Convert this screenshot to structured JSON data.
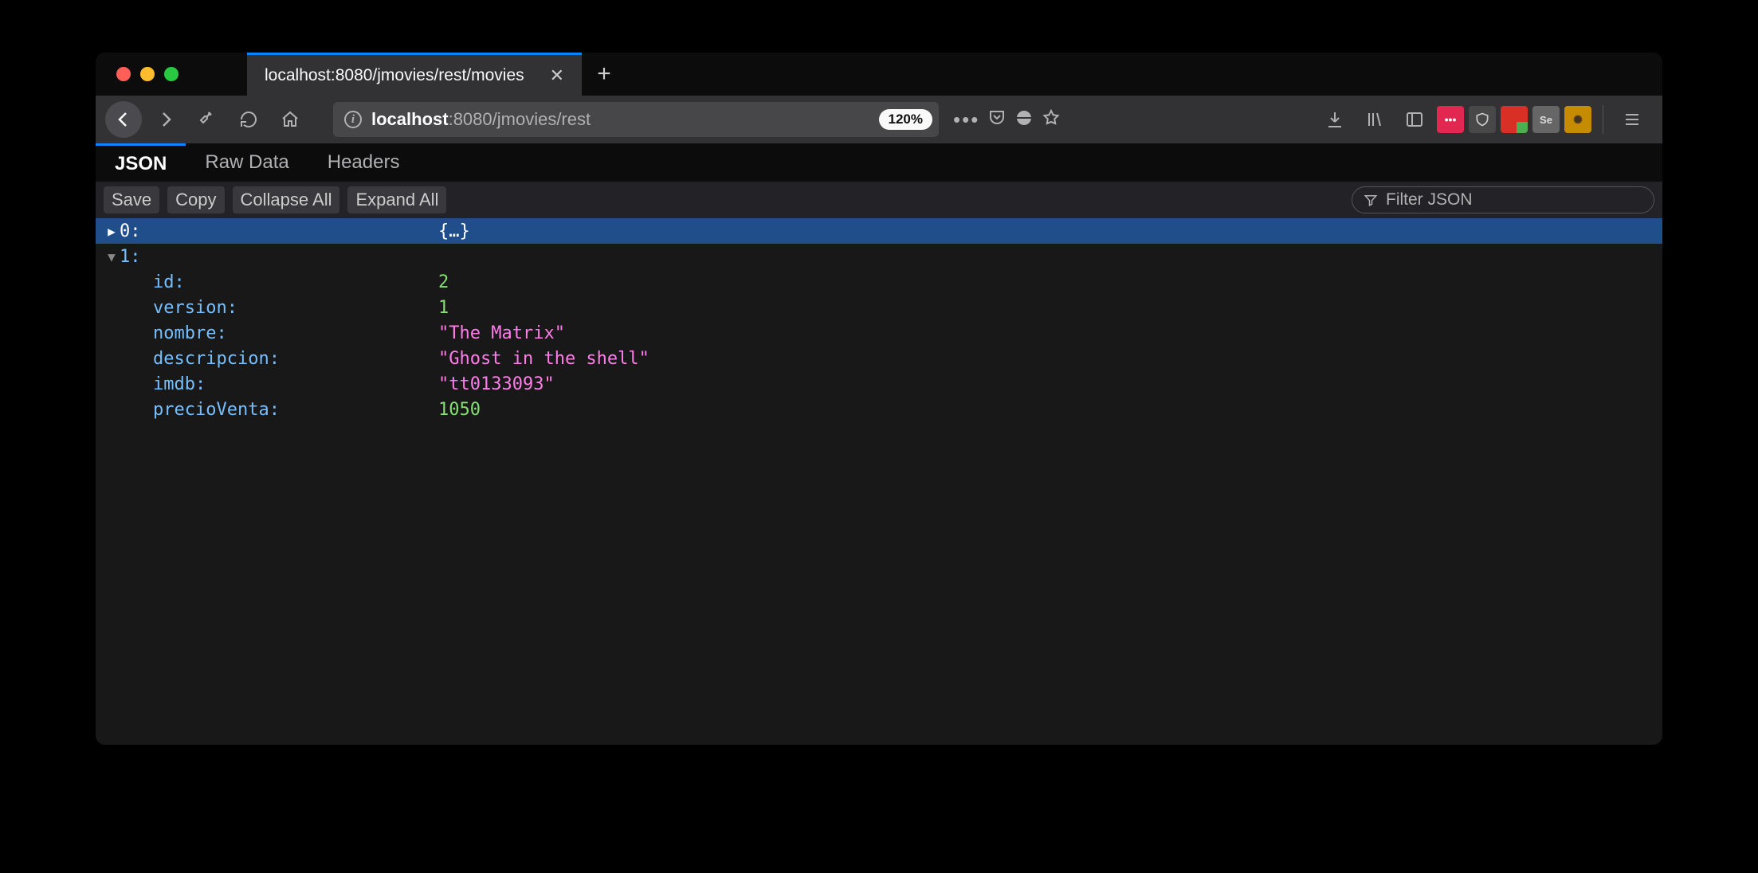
{
  "tab": {
    "title": "localhost:8080/jmovies/rest/movies"
  },
  "url": {
    "host": "localhost",
    "rest": ":8080/jmovies/rest"
  },
  "zoom": "120%",
  "jv_tabs": {
    "json": "JSON",
    "raw": "Raw Data",
    "headers": "Headers"
  },
  "toolbar": {
    "save": "Save",
    "copy": "Copy",
    "collapse": "Collapse All",
    "expand": "Expand All"
  },
  "filter": {
    "placeholder": "Filter JSON"
  },
  "tree": {
    "row0": {
      "key": "0:",
      "val": "{…}"
    },
    "row1": {
      "key": "1:"
    },
    "props": {
      "id": {
        "key": "id:",
        "val": "2"
      },
      "version": {
        "key": "version:",
        "val": "1"
      },
      "nombre": {
        "key": "nombre:",
        "val": "\"The Matrix\""
      },
      "descripcion": {
        "key": "descripcion:",
        "val": "\"Ghost in the shell\""
      },
      "imdb": {
        "key": "imdb:",
        "val": "\"tt0133093\""
      },
      "precioVenta": {
        "key": "precioVenta:",
        "val": "1050"
      }
    }
  }
}
